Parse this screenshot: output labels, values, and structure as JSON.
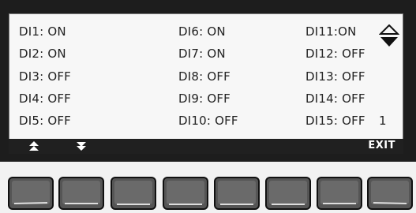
{
  "di_states": {
    "col1": [
      "DI1: ON",
      "DI2: ON",
      "DI3: OFF",
      "DI4: OFF",
      "DI5: OFF"
    ],
    "col2": [
      "DI6: ON",
      "DI7: ON",
      "DI8: OFF",
      "DI9: OFF",
      "DI10: OFF"
    ],
    "col3": [
      "DI11:ON",
      "DI12: OFF",
      "DI13: OFF",
      "DI14: OFF",
      "DI15: OFF"
    ]
  },
  "page_indicator": "1",
  "softkeys": {
    "up_icon": "double-up-arrow-icon",
    "down_icon": "double-down-arrow-icon",
    "exit_label": "EXIT"
  },
  "scroll_icon": "up-down-triangle-icon",
  "colors": {
    "bezel": "#1d1d1d",
    "screen": "#f7f7f7",
    "softkey_bar": "#202020"
  }
}
